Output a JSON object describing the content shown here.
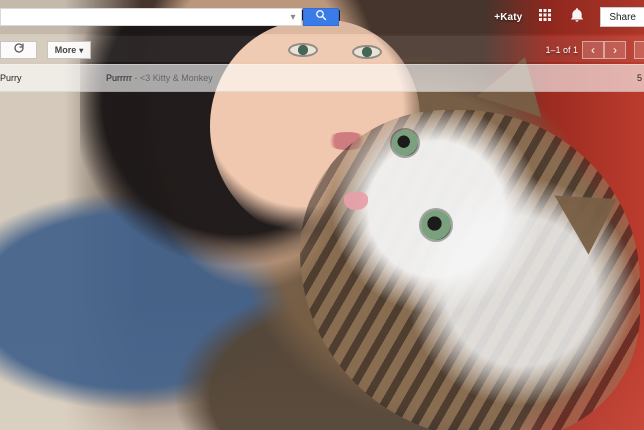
{
  "header": {
    "search": {
      "value": "",
      "placeholder": ""
    },
    "search_dropdown_icon": "▾",
    "user": "+Katy",
    "share_label": "Share"
  },
  "toolbar": {
    "more_label": "More",
    "pagination": "1–1 of 1",
    "prev_glyph": "‹",
    "next_glyph": "›"
  },
  "email": {
    "sender": "Purry",
    "subject": "Purrrrr",
    "snippet": " - <3 Kitty & Monkey",
    "time_partial": "5"
  },
  "colors": {
    "search_button": "#3B7BE8"
  }
}
